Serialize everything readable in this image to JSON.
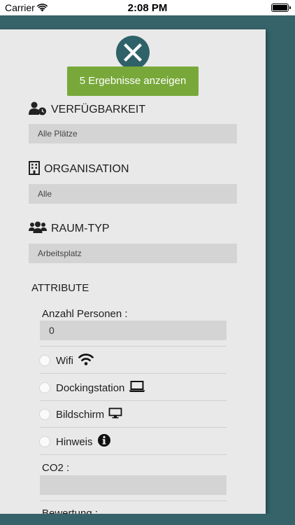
{
  "status_bar": {
    "carrier": "Carrier",
    "time": "2:08 PM"
  },
  "close_button": {
    "icon": "close-x-icon"
  },
  "results_button": {
    "label": "5 Ergebnisse anzeigen"
  },
  "sections": {
    "availability": {
      "title": "VERFÜGBARKEIT",
      "value": "Alle Plätze",
      "icon": "user-clock-icon"
    },
    "organisation": {
      "title": "ORGANISATION",
      "value": "Alle",
      "icon": "building-icon"
    },
    "room_type": {
      "title": "RAUM-TYP",
      "value": "Arbeitsplatz",
      "icon": "users-icon"
    }
  },
  "attributes": {
    "title": "ATTRIBUTE",
    "persons": {
      "label": "Anzahl Personen :",
      "value": "0"
    },
    "options": [
      {
        "label": "Wifi",
        "icon": "wifi-icon",
        "checked": false
      },
      {
        "label": "Dockingstation",
        "icon": "laptop-icon",
        "checked": false
      },
      {
        "label": "Bildschirm",
        "icon": "monitor-icon",
        "checked": false
      },
      {
        "label": "Hinweis",
        "icon": "info-icon",
        "checked": false
      }
    ],
    "co2": {
      "label": "CO2 :",
      "value": ""
    },
    "rating": {
      "label": "Bewertung :"
    }
  },
  "colors": {
    "accent_green": "#78a83a",
    "teal": "#36626a",
    "panel": "#e9e9e9"
  }
}
